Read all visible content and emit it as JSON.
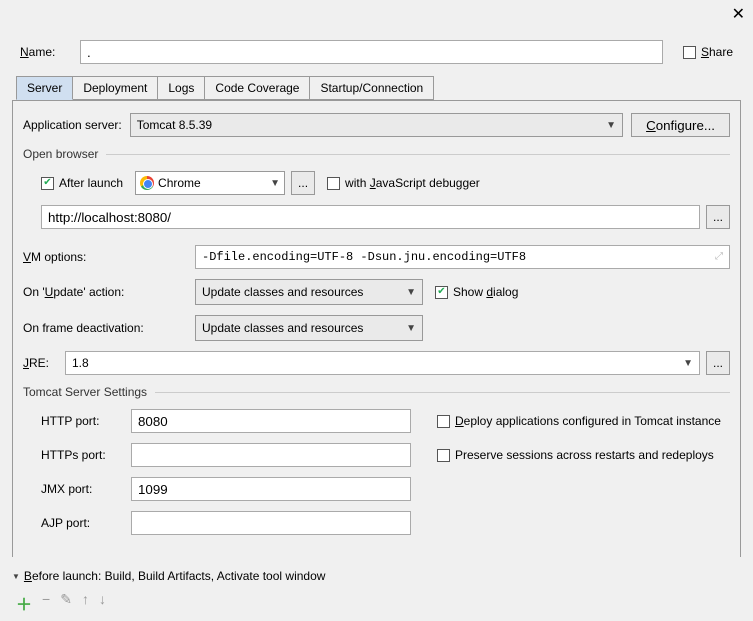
{
  "close": "✕",
  "nameLabel": "Name:",
  "nameValue": ".",
  "shareLabel": "Share",
  "tabs": [
    "Server",
    "Deployment",
    "Logs",
    "Code Coverage",
    "Startup/Connection"
  ],
  "appServer": {
    "label": "Application server:",
    "value": "Tomcat 8.5.39",
    "configure": "Configure..."
  },
  "openBrowser": {
    "section": "Open browser",
    "afterLaunch": "After launch",
    "browser": "Chrome",
    "browseBtn": "...",
    "jsDebugger": "with JavaScript debugger",
    "url": "http://localhost:8080/"
  },
  "vm": {
    "label": "VM options:",
    "value": "-Dfile.encoding=UTF-8 -Dsun.jnu.encoding=UTF8"
  },
  "update": {
    "label": "On 'Update' action:",
    "value": "Update classes and resources",
    "showDialog": "Show dialog"
  },
  "frame": {
    "label": "On frame deactivation:",
    "value": "Update classes and resources"
  },
  "jre": {
    "label": "JRE:",
    "value": "1.8"
  },
  "server": {
    "section": "Tomcat Server Settings",
    "httpLabel": "HTTP port:",
    "httpValue": "8080",
    "httpsLabel": "HTTPs port:",
    "httpsValue": "",
    "jmxLabel": "JMX port:",
    "jmxValue": "1099",
    "ajpLabel": "AJP port:",
    "ajpValue": "",
    "deploy": "Deploy applications configured in Tomcat instance",
    "preserve": "Preserve sessions across restarts and redeploys"
  },
  "beforeLaunch": "Before launch: Build, Build Artifacts, Activate tool window"
}
